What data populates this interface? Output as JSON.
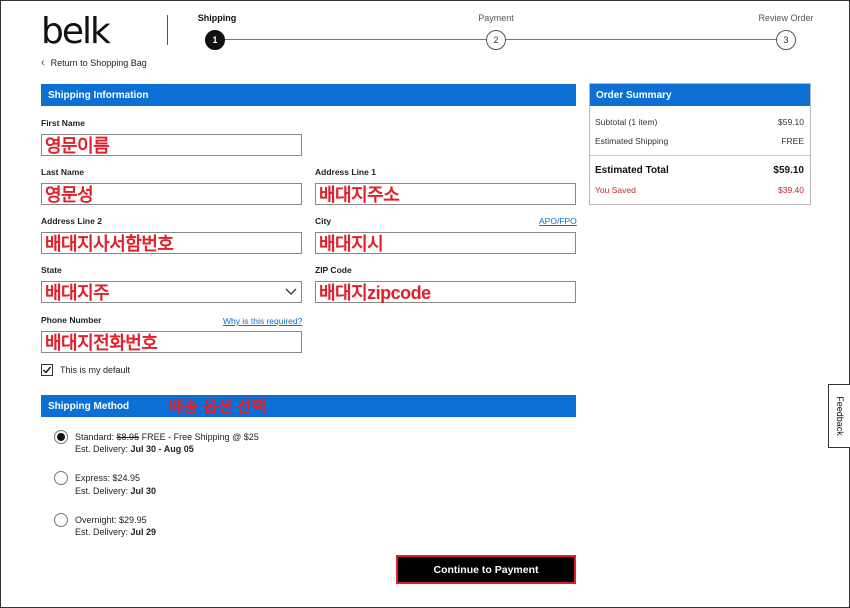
{
  "header": {
    "logo": "belk",
    "back_link": "Return to Shopping Bag"
  },
  "stepper": {
    "steps": [
      {
        "label": "Shipping",
        "number": "1",
        "active": true
      },
      {
        "label": "Payment",
        "number": "2",
        "active": false
      },
      {
        "label": "Review Order",
        "number": "3",
        "active": false
      }
    ]
  },
  "shipping_info": {
    "title": "Shipping Information",
    "first_name": {
      "label": "First Name",
      "value": "영문이름"
    },
    "last_name": {
      "label": "Last Name",
      "value": "영문성"
    },
    "address1": {
      "label": "Address Line 1",
      "value": "배대지주소"
    },
    "address2": {
      "label": "Address Line 2",
      "value": "배대지사서함번호"
    },
    "city": {
      "label": "City",
      "value": "배대지시",
      "link": "APO/FPO"
    },
    "state": {
      "label": "State",
      "value": "배대지주"
    },
    "zip": {
      "label": "ZIP Code",
      "value": "배대지zipcode"
    },
    "phone": {
      "label": "Phone Number",
      "value": "배대지전화번호",
      "link": "Why is this required?"
    },
    "default_checkbox": {
      "label": "This is my default",
      "checked": true
    }
  },
  "shipping_method": {
    "title": "Shipping Method",
    "annotation": "배송 옵션 선택",
    "options": [
      {
        "name": "Standard:",
        "old_price": "$8.95",
        "price": "FREE - Free Shipping @ $25",
        "est_label": "Est. Delivery:",
        "est_value": "Jul 30 - Aug 05",
        "selected": true
      },
      {
        "name": "Express:",
        "price": "$24.95",
        "est_label": "Est. Delivery:",
        "est_value": "Jul 30",
        "selected": false
      },
      {
        "name": "Overnight:",
        "price": "$29.95",
        "est_label": "Est. Delivery:",
        "est_value": "Jul 29",
        "selected": false
      }
    ]
  },
  "continue_button": "Continue to Payment",
  "order_summary": {
    "title": "Order Summary",
    "subtotal_label": "Subtotal (1 item)",
    "subtotal_value": "$59.10",
    "shipping_label": "Estimated Shipping",
    "shipping_value": "FREE",
    "total_label": "Estimated Total",
    "total_value": "$59.10",
    "saved_label": "You Saved",
    "saved_value": "$39.40"
  },
  "feedback": "Feedback",
  "colors": {
    "accent_blue": "#0b6fd3",
    "annotation_red": "#e0202a",
    "saved_red": "#c0282d"
  }
}
